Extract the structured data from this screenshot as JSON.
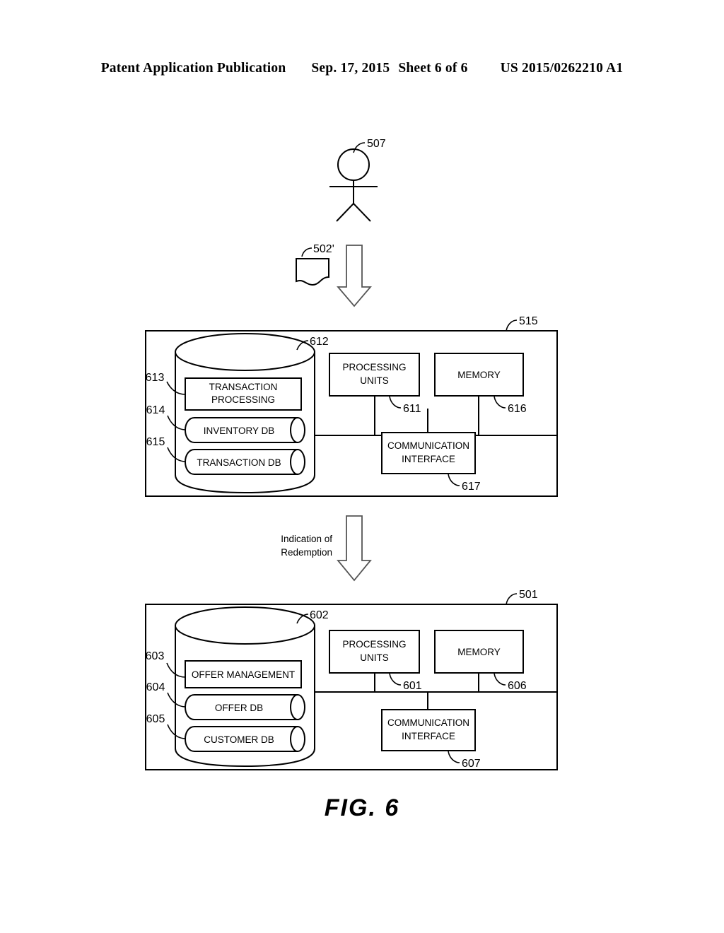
{
  "header": {
    "publication": "Patent Application Publication",
    "date": "Sep. 17, 2015",
    "sheet": "Sheet 6 of 6",
    "patent_number": "US 2015/0262210 A1"
  },
  "figure": {
    "caption": "FIG.  6"
  },
  "actor": {
    "ref": "507",
    "name": "user-stick-figure"
  },
  "document_symbol": {
    "ref": "502'",
    "name": "coupon-document"
  },
  "flow_arrows": [
    {
      "name": "arrow-user-to-merchant",
      "label": ""
    },
    {
      "name": "arrow-merchant-to-offer-system",
      "label_line1": "Indication of",
      "label_line2": "Redemption"
    }
  ],
  "systems": [
    {
      "name": "merchant-system",
      "ref": "515",
      "storage": {
        "ref": "612",
        "modules": [
          {
            "ref": "613",
            "label": "TRANSACTION PROCESSING",
            "shape": "rect"
          },
          {
            "ref": "614",
            "label": "INVENTORY DB",
            "shape": "cylinder"
          },
          {
            "ref": "615",
            "label": "TRANSACTION DB",
            "shape": "cylinder"
          }
        ]
      },
      "components": [
        {
          "ref": "611",
          "label": "PROCESSING UNITS",
          "name": "processing-units"
        },
        {
          "ref": "616",
          "label": "MEMORY",
          "name": "memory"
        },
        {
          "ref": "617",
          "label": "COMMUNICATION INTERFACE",
          "name": "communication-interface"
        }
      ]
    },
    {
      "name": "offer-system",
      "ref": "501",
      "storage": {
        "ref": "602",
        "modules": [
          {
            "ref": "603",
            "label": "OFFER MANAGEMENT",
            "shape": "rect"
          },
          {
            "ref": "604",
            "label": "OFFER DB",
            "shape": "cylinder"
          },
          {
            "ref": "605",
            "label": "CUSTOMER DB",
            "shape": "cylinder"
          }
        ]
      },
      "components": [
        {
          "ref": "601",
          "label": "PROCESSING UNITS",
          "name": "processing-units"
        },
        {
          "ref": "606",
          "label": "MEMORY",
          "name": "memory"
        },
        {
          "ref": "607",
          "label": "COMMUNICATION INTERFACE",
          "name": "communication-interface"
        }
      ]
    }
  ],
  "colors": {
    "ink": "#000000",
    "paper": "#ffffff",
    "arrow_stroke": "#555555"
  }
}
